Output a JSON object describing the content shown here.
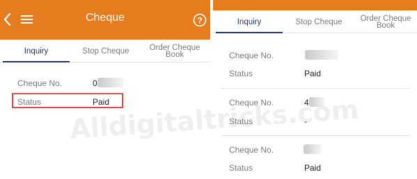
{
  "left": {
    "header": {
      "title": "Cheque"
    },
    "tabs": [
      "Inquiry",
      "Stop Cheque",
      "Order Cheque Book"
    ],
    "active_tab": "Inquiry",
    "result": {
      "cheque_label": "Cheque No.",
      "cheque_value_partial": "0",
      "status_label": "Status",
      "status_value": "Paid"
    }
  },
  "right": {
    "tabs": [
      "Inquiry",
      "Stop Cheque",
      "Order Cheque Book"
    ],
    "active_tab": "Inquiry",
    "results": [
      {
        "cheque_label": "Cheque No.",
        "cheque_value_partial": "",
        "status_label": "Status",
        "status_value": "Paid"
      },
      {
        "cheque_label": "Cheque No.",
        "cheque_value_partial": "4",
        "status_label": "Status",
        "status_value": "-"
      },
      {
        "cheque_label": "Cheque No.",
        "cheque_value_partial": "",
        "status_label": "Status",
        "status_value": "Paid"
      }
    ]
  },
  "watermark": "Alldigitaltricks.com",
  "colors": {
    "header_orange": "#e57d1f",
    "active_tab": "#1f3560",
    "highlight_red": "#e24a4a"
  },
  "icons": [
    "back-icon",
    "menu-icon",
    "help-icon"
  ]
}
